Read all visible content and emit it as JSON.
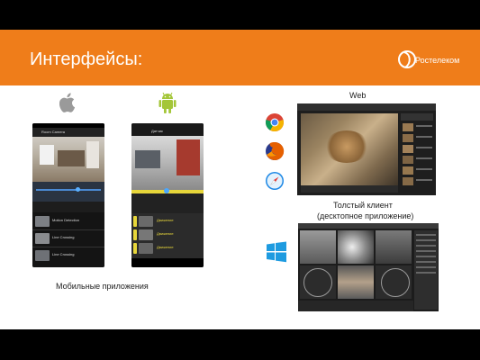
{
  "slide": {
    "title": "Интерфейсы:",
    "logo_text": "Ростелеком"
  },
  "captions": {
    "mobile": "Мобильные приложения",
    "web": "Web",
    "desktop_line1": "Толстый клиент",
    "desktop_line2": "(десктопное приложение)"
  },
  "ios_app": {
    "header": "Room Camera",
    "events": [
      "Motion Detection",
      "Line Crossing",
      "Line Crossing"
    ]
  },
  "android_app": {
    "header": "Датчик",
    "events": [
      "Движение",
      "Движение",
      "Движение"
    ]
  },
  "icons": [
    "apple-icon",
    "android-icon",
    "chrome-icon",
    "firefox-icon",
    "safari-icon",
    "windows-icon"
  ],
  "colors": {
    "accent": "#ef7d1a",
    "android_green": "#a4c639",
    "windows_blue": "#1e9be0"
  }
}
